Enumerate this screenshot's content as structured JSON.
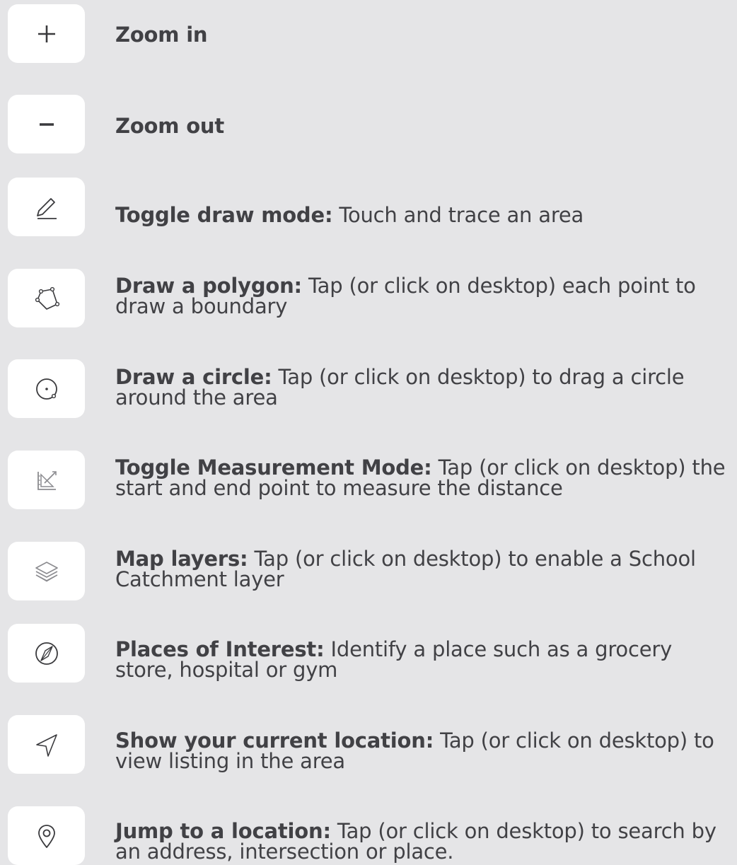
{
  "colors": {
    "background": "#e5e5e7",
    "button": "#ffffff",
    "text": "#414145",
    "icon": "#3a3a3d",
    "icon_light": "#8c8c90"
  },
  "items": [
    {
      "icon": "plus-icon",
      "title": "Zoom in",
      "text": ""
    },
    {
      "icon": "minus-icon",
      "title": "Zoom out",
      "text": ""
    },
    {
      "icon": "pencil-icon",
      "title": "Toggle draw mode:",
      "text": " Touch and trace an area"
    },
    {
      "icon": "polygon-icon",
      "title": "Draw a polygon:",
      "text": " Tap (or click on desktop) each point to draw a boundary"
    },
    {
      "icon": "circle-icon",
      "title": "Draw a circle:",
      "text": " Tap (or click on desktop) to drag a circle around the area"
    },
    {
      "icon": "measure-icon",
      "title": "Toggle Measurement Mode:",
      "text": " Tap (or click on desktop) the start and end point to measure the distance"
    },
    {
      "icon": "layers-icon",
      "title": "Map layers:",
      "text": "  Tap (or click on desktop) to enable a School Catchment layer"
    },
    {
      "icon": "compass-icon",
      "title": "Places of Interest:",
      "text": "  Identify a place such as a grocery store, hospital or gym"
    },
    {
      "icon": "location-arrow-icon",
      "title": "Show your current location:",
      "text": "  Tap (or click on desktop) to view listing in the area"
    },
    {
      "icon": "map-pin-icon",
      "title": "Jump to a location:",
      "text": "  Tap (or click on desktop) to search by an address, intersection or place."
    }
  ]
}
